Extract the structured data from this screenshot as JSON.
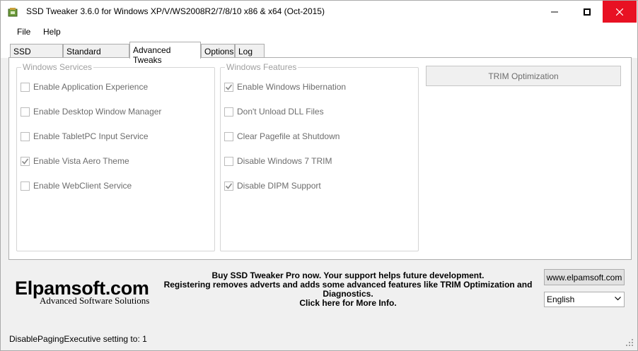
{
  "window": {
    "title": "SSD Tweaker 3.6.0 for Windows XP/V/WS2008R2/7/8/10 x86 & x64 (Oct-2015)",
    "close_color": "#e81123"
  },
  "menu": [
    "File",
    "Help"
  ],
  "tabs": [
    {
      "label": "SSD Tweaker",
      "active": false
    },
    {
      "label": "Standard Tweaks",
      "active": false
    },
    {
      "label": "Advanced Tweaks",
      "active": true
    },
    {
      "label": "Options",
      "active": false
    },
    {
      "label": "Log",
      "active": false
    }
  ],
  "services": {
    "legend": "Windows Services",
    "items": [
      {
        "label": "Enable Application Experience",
        "checked": false
      },
      {
        "label": "Enable Desktop Window Manager",
        "checked": false
      },
      {
        "label": "Enable TabletPC Input Service",
        "checked": false
      },
      {
        "label": "Enable Vista Aero Theme",
        "checked": true
      },
      {
        "label": "Enable WebClient Service",
        "checked": false
      }
    ]
  },
  "features": {
    "legend": "Windows Features",
    "items": [
      {
        "label": "Enable Windows Hibernation",
        "checked": true
      },
      {
        "label": "Don't Unload DLL Files",
        "checked": false
      },
      {
        "label": "Clear Pagefile at Shutdown",
        "checked": false
      },
      {
        "label": "Disable Windows 7 TRIM",
        "checked": false
      },
      {
        "label": "Disable DIPM Support",
        "checked": true
      }
    ]
  },
  "trim_button": "TRIM Optimization",
  "logo": {
    "main": "Elpamsoft.com",
    "sub": "Advanced Software Solutions"
  },
  "promo": {
    "line1": "Buy SSD Tweaker Pro now. Your support helps future development.",
    "line2": "Registering removes adverts and adds some advanced features like TRIM Optimization and Diagnostics.",
    "line3": "Click here for More Info."
  },
  "website_button": "www.elpamsoft.com",
  "language": {
    "selected": "English"
  },
  "status": "DisablePagingExecutive setting to: 1"
}
